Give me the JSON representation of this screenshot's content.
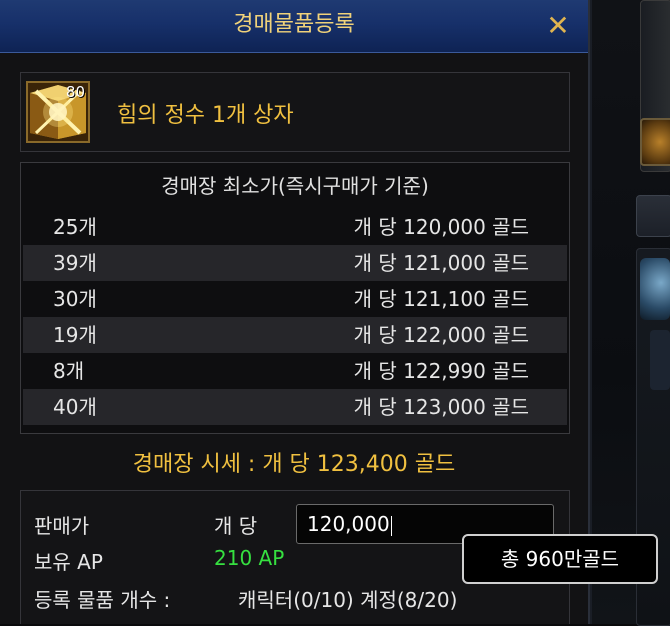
{
  "window": {
    "title": "경매물품등록",
    "close_label": "✕"
  },
  "item": {
    "level": "80",
    "name": "힘의 정수 1개 상자",
    "icon": "gold-box-icon"
  },
  "price_table": {
    "header": "경매장 최소가(즉시구매가 기준)",
    "rows": [
      {
        "qty": "25개",
        "price": "개 당 120,000 골드"
      },
      {
        "qty": "39개",
        "price": "개 당 121,000 골드"
      },
      {
        "qty": "30개",
        "price": "개 당 121,100 골드"
      },
      {
        "qty": "19개",
        "price": "개 당 122,000 골드"
      },
      {
        "qty": "8개",
        "price": "개 당 122,990 골드"
      },
      {
        "qty": "40개",
        "price": "개 당 123,000 골드"
      }
    ]
  },
  "market_price": "경매장 시세 : 개 당 123,400 골드",
  "form": {
    "sell_price_label": "판매가",
    "per_unit_label": "개 당",
    "sell_price_value": "120,000",
    "ap_label": "보유 AP",
    "ap_value": "210 AP",
    "register_count_label": "등록 물품 개수 :",
    "register_count_value": "캐릭터(0/10) 계정(8/20)"
  },
  "tooltip": {
    "text": "총 960만골드"
  },
  "colors": {
    "title_bar": "#17306a",
    "gold_text": "#f0c040",
    "ap_green": "#36e040"
  }
}
